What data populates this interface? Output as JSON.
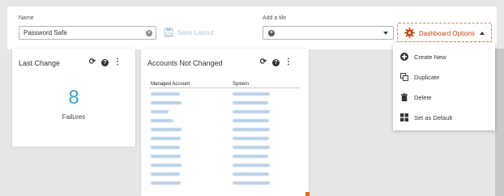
{
  "toolbar": {
    "name_label": "Name",
    "name_value": "Password Safe",
    "save_layout_label": "Save Layout",
    "add_tile_label": "Add a tile",
    "dashboard_options_label": "Dashboard Options"
  },
  "tiles": {
    "last_change": {
      "title": "Last Change",
      "count": "8",
      "count_label": "Failures"
    },
    "accounts": {
      "title": "Accounts Not Changed",
      "col_managed": "Managed Account",
      "col_system": "System"
    }
  },
  "menu": {
    "items": [
      {
        "label": "Create New",
        "icon": "plus-circle-icon"
      },
      {
        "label": "Duplicate",
        "icon": "duplicate-icon"
      },
      {
        "label": "Delete",
        "icon": "trash-icon"
      },
      {
        "label": "Set as Default",
        "icon": "layout-grid-icon"
      }
    ]
  },
  "colors": {
    "accent": "#c1440e",
    "count": "#3aa3d3",
    "blurred_text": "#b8d0ea"
  }
}
